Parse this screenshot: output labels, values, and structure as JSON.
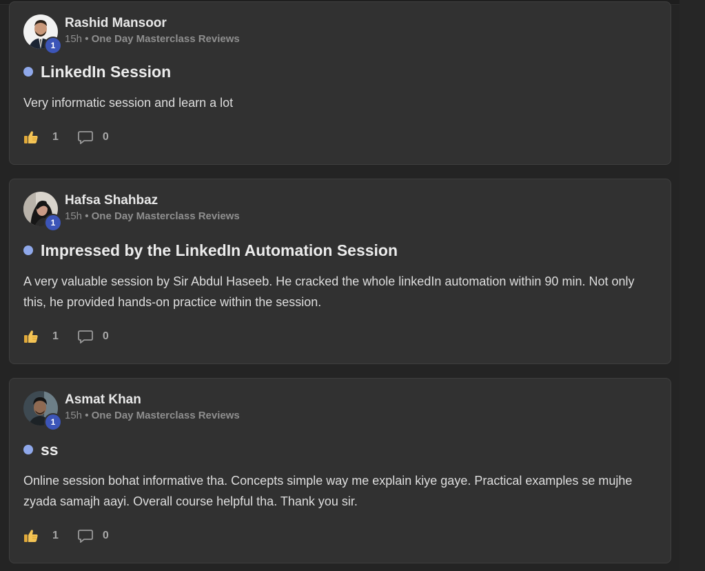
{
  "posts": [
    {
      "author": "Rashid Mansoor",
      "level": "1",
      "time": "15h",
      "separator": "•",
      "category": "One Day Masterclass Reviews",
      "title": "LinkedIn Session",
      "body": "Very informatic session and learn a lot",
      "likes": "1",
      "comments": "0"
    },
    {
      "author": "Hafsa Shahbaz",
      "level": "1",
      "time": "15h",
      "separator": "•",
      "category": "One Day Masterclass Reviews",
      "title": "Impressed by the LinkedIn Automation Session",
      "body": "A very valuable session by Sir Abdul Haseeb. He cracked the whole linkedIn automation within 90 min. Not only this, he provided hands-on practice within the session.",
      "likes": "1",
      "comments": "0"
    },
    {
      "author": "Asmat Khan",
      "level": "1",
      "time": "15h",
      "separator": "•",
      "category": "One Day Masterclass Reviews",
      "title": "ss",
      "body": "Online session bohat informative tha. Concepts simple way me explain kiye gaye. Practical examples se mujhe zyada samajh aayi. Overall course helpful tha. Thank you sir.",
      "likes": "1",
      "comments": "0"
    }
  ],
  "icons": {
    "like": "thumbs-up-icon",
    "comment": "comment-bubble-icon"
  },
  "colors": {
    "background": "#242424",
    "card": "#313131",
    "title_dot": "#8fa8ea",
    "level_badge": "#3c55b8"
  }
}
